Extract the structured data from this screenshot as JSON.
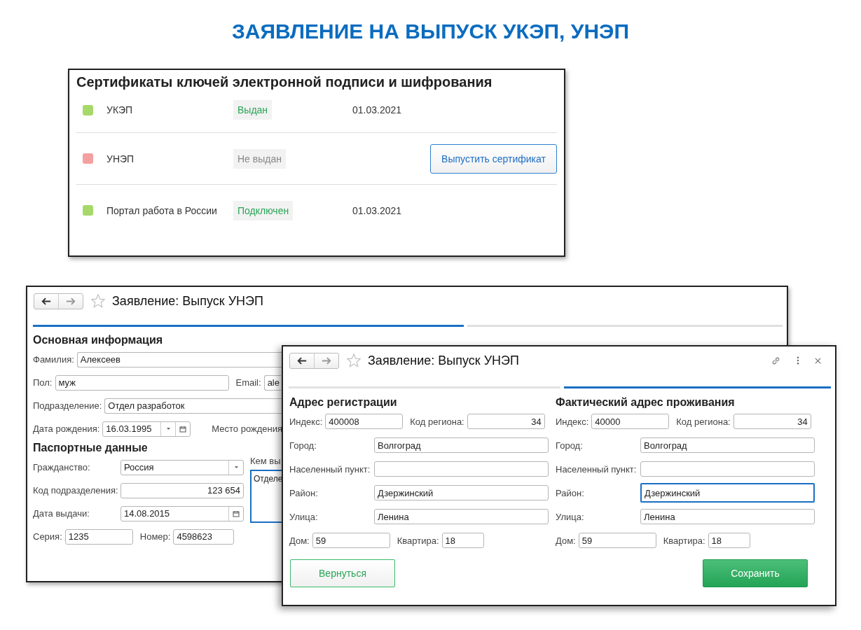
{
  "page_title": "ЗАЯВЛЕНИЕ НА ВЫПУСК УКЭП, УНЭП",
  "certificates": {
    "title": "Сертификаты ключей электронной подписи и шифрования",
    "rows": [
      {
        "color": "#a6d96a",
        "name": "УКЭП",
        "status": "Выдан",
        "status_ok": true,
        "date": "01.03.2021"
      },
      {
        "color": "#f4a0a0",
        "name": "УНЭП",
        "status": "Не выдан",
        "status_ok": false,
        "action": "Выпустить сертификат"
      },
      {
        "color": "#a6d96a",
        "name": "Портал работа в России",
        "status": "Подключен",
        "status_ok": true,
        "date": "01.03.2021"
      }
    ]
  },
  "back_window": {
    "title": "Заявление: Выпуск УНЭП",
    "section_main": "Основная информация",
    "surname": {
      "label": "Фамилия:",
      "value": "Алексеев"
    },
    "gender": {
      "label": "Пол:",
      "value": "муж"
    },
    "email": {
      "label": "Email:",
      "value": "ale"
    },
    "department": {
      "label": "Подразделение:",
      "value": "Отдел разработок"
    },
    "birth_date": {
      "label": "Дата рождения:",
      "value": "16.03.1995"
    },
    "birth_place_label": "Место рождения",
    "section_passport": "Паспортные данные",
    "citizenship": {
      "label": "Гражданство:",
      "value": "Россия"
    },
    "division_code": {
      "label": "Код подразделения:",
      "value": "123 654"
    },
    "issue_date": {
      "label": "Дата выдачи:",
      "value": "14.08.2015"
    },
    "series": {
      "label": "Серия:",
      "value": "1235"
    },
    "number": {
      "label": "Номер:",
      "value": "4598623"
    },
    "issued_by": {
      "label": "Кем вы",
      "value": "Отделе"
    }
  },
  "front_window": {
    "title": "Заявление: Выпуск УНЭП",
    "columns": [
      {
        "heading": "Адрес регистрации",
        "index": {
          "label": "Индекс:",
          "value": "400008"
        },
        "region_code": {
          "label": "Код региона:",
          "value": "34"
        },
        "rows": [
          {
            "label": "Город:",
            "value": "Волгоград",
            "focused": false
          },
          {
            "label": "Населенный пункт:",
            "focused": false
          },
          {
            "label": "Район:",
            "value": "Дзержинский",
            "focused": false
          },
          {
            "label": "Улица:",
            "value": "Ленина",
            "focused": false
          }
        ],
        "house": {
          "label": "Дом:",
          "value": "59"
        },
        "apartment": {
          "label": "Квартира:",
          "value": "18"
        }
      },
      {
        "heading": "Фактический адрес проживания",
        "index": {
          "label": "Индекс:",
          "value": "40000"
        },
        "region_code": {
          "label": "Код региона:",
          "value": "34"
        },
        "rows": [
          {
            "label": "Город:",
            "value": "Волгоград",
            "focused": false
          },
          {
            "label": "Населенный пункт:",
            "focused": false
          },
          {
            "label": "Район:",
            "value": "Дзержинский",
            "focused": true
          },
          {
            "label": "Улица:",
            "value": "Ленина",
            "focused": false
          }
        ],
        "house": {
          "label": "Дом:",
          "value": "59"
        },
        "apartment": {
          "label": "Квартира:",
          "value": "18"
        }
      }
    ],
    "buttons": [
      {
        "label": "Вернуться",
        "kind": "secondary"
      },
      {
        "label": "Сохранить",
        "kind": "primary"
      }
    ]
  }
}
